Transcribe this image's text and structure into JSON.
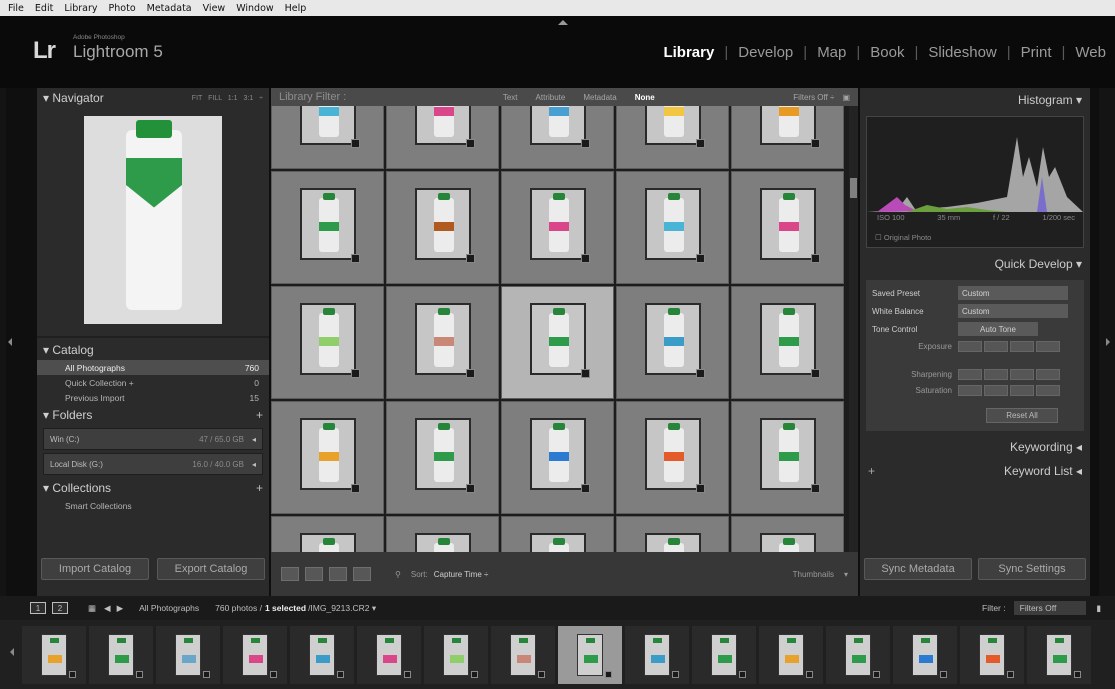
{
  "menu": [
    "File",
    "Edit",
    "Library",
    "Photo",
    "Metadata",
    "View",
    "Window",
    "Help"
  ],
  "identity": {
    "lr": "Lr",
    "adobe": "Adobe Photoshop",
    "name": "Lightroom 5"
  },
  "modules": [
    "Library",
    "Develop",
    "Map",
    "Book",
    "Slideshow",
    "Print",
    "Web"
  ],
  "active_module": "Library",
  "navigator": {
    "title": "Navigator",
    "options": "FIT FILL 1:1 3:1 ÷"
  },
  "catalog": {
    "title": "Catalog",
    "items": [
      {
        "label": "All Photographs",
        "count": "760",
        "selected": true
      },
      {
        "label": "Quick Collection +",
        "count": "0",
        "selected": false
      },
      {
        "label": "Previous Import",
        "count": "15",
        "selected": false
      }
    ]
  },
  "folders": {
    "title": "Folders",
    "volumes": [
      {
        "label": "Win (C:)",
        "stats": "47 / 65.0 GB"
      },
      {
        "label": "Local Disk (G:)",
        "stats": "16.0 / 40.0 GB"
      }
    ]
  },
  "collections": {
    "title": "Collections",
    "items": [
      "Smart Collections"
    ]
  },
  "left_buttons": {
    "import": "Import Catalog",
    "export": "Export Catalog"
  },
  "filter_bar": {
    "label": "Library Filter :",
    "options": [
      "Text",
      "Attribute",
      "Metadata",
      "None"
    ],
    "active": "None",
    "filters_off": "Filters Off ÷"
  },
  "grid": {
    "rows": [
      [
        "#4ab4d6",
        "#d9468a",
        "#48a0d2",
        "#f2c641",
        "#e79a24"
      ],
      [
        "#2e9b4a",
        "#b05a20",
        "#d9468a",
        "#4ab4d6",
        "#d9468a"
      ],
      [
        "#8fce6a",
        "#c98778",
        "#2e9b4a",
        "#3c9cc8",
        "#2e9b4a"
      ],
      [
        "#e8a12b",
        "#2e9b4a",
        "#2a7bd1",
        "#e35a2b",
        "#2e9b4a"
      ],
      [
        "#9a9a9a",
        "#9a9a9a",
        "#9a9a9a",
        "#9a9a9a",
        "#9a9a9a"
      ]
    ],
    "selected": [
      2,
      2
    ]
  },
  "toolbar": {
    "sort_label": "Sort:",
    "sort_value": "Capture Time ÷",
    "thumbnails": "Thumbnails"
  },
  "histogram": {
    "title": "Histogram",
    "iso": "ISO 100",
    "focal": "35 mm",
    "aperture": "f / 22",
    "shutter": "1/200 sec",
    "original": "Original Photo"
  },
  "quick_develop": {
    "title": "Quick Develop",
    "saved_preset": {
      "label": "Saved Preset",
      "value": "Custom"
    },
    "white_balance": {
      "label": "White Balance",
      "value": "Custom"
    },
    "tone_control": {
      "label": "Tone Control",
      "button": "Auto Tone"
    },
    "exposure": "Exposure",
    "sharpening": "Sharpening",
    "saturation": "Saturation",
    "reset": "Reset All"
  },
  "keywording": "Keywording",
  "keyword_list": "Keyword List",
  "right_buttons": {
    "sync_meta": "Sync Metadata",
    "sync_settings": "Sync Settings"
  },
  "secondary_bar": {
    "mon1": "1",
    "mon2": "2",
    "source": "All Photographs",
    "count_prefix": "760 photos /",
    "selected": "1 selected",
    "file": "/IMG_9213.CR2 ▾",
    "filter_label": "Filter :",
    "filter_value": "Filters Off"
  },
  "filmstrip": [
    "#e8a12b",
    "#2e9b4a",
    "#6aa6c8",
    "#d9468a",
    "#3c9cc8",
    "#d9468a",
    "#8fce6a",
    "#c98778",
    "#2e9b4a",
    "#3c9cc8",
    "#2e9b4a",
    "#e8a12b",
    "#2e9b4a",
    "#2a7bd1",
    "#e35a2b",
    "#2e9b4a"
  ],
  "filmstrip_selected": 8
}
